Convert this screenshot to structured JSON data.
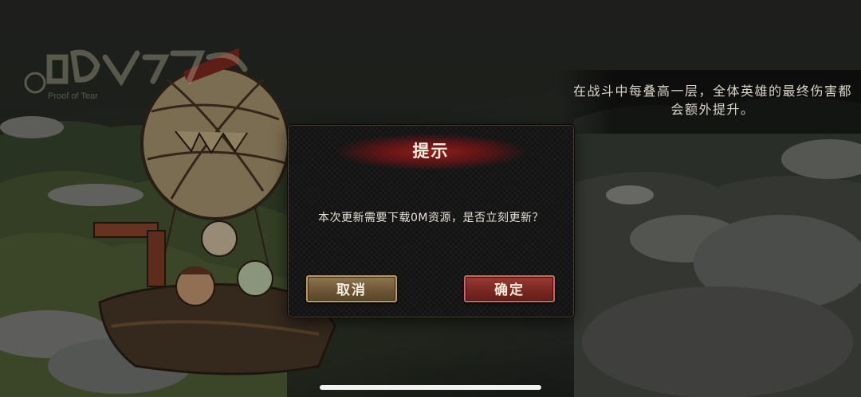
{
  "background": {
    "tip_text": "在战斗中每叠高一层，全体英雄的最终伤害都会额外提升。",
    "logo_caption": "Proof of Tear"
  },
  "dialog": {
    "title": "提示",
    "message": "本次更新需要下载0M资源，是否立刻更新？",
    "cancel_label": "取消",
    "confirm_label": "确定"
  },
  "colors": {
    "title_band": "#8c1e1e",
    "cancel_button": "#6d5736",
    "confirm_button": "#7b2823"
  }
}
